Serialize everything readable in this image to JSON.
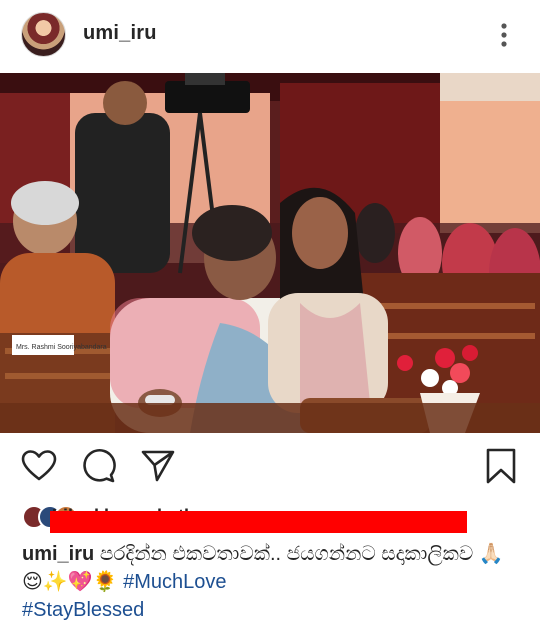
{
  "header": {
    "username": "umi_iru",
    "avatar_icon": "profile-avatar",
    "more_icon": "vertical-dots-icon"
  },
  "photo": {
    "placard_text": "Mrs. Rashmi Sooriyabandara"
  },
  "actions": {
    "like_icon": "heart-outline-icon",
    "comment_icon": "comment-bubble-icon",
    "share_icon": "paper-plane-icon",
    "save_icon": "bookmark-icon"
  },
  "likes": {
    "text": "Liked by and others",
    "redacted": true,
    "redaction_color": "#ff0000"
  },
  "caption": {
    "username": "umi_iru",
    "text": "පරදින්න එකවතාවක්.. ජයගන්නට සදාකාලිකව 🙏🏻😌✨💖🌻",
    "hashtag_1": "#MuchLove",
    "hashtag_2": "#StayBlessed",
    "hashtag_color": "#1d4f91"
  }
}
